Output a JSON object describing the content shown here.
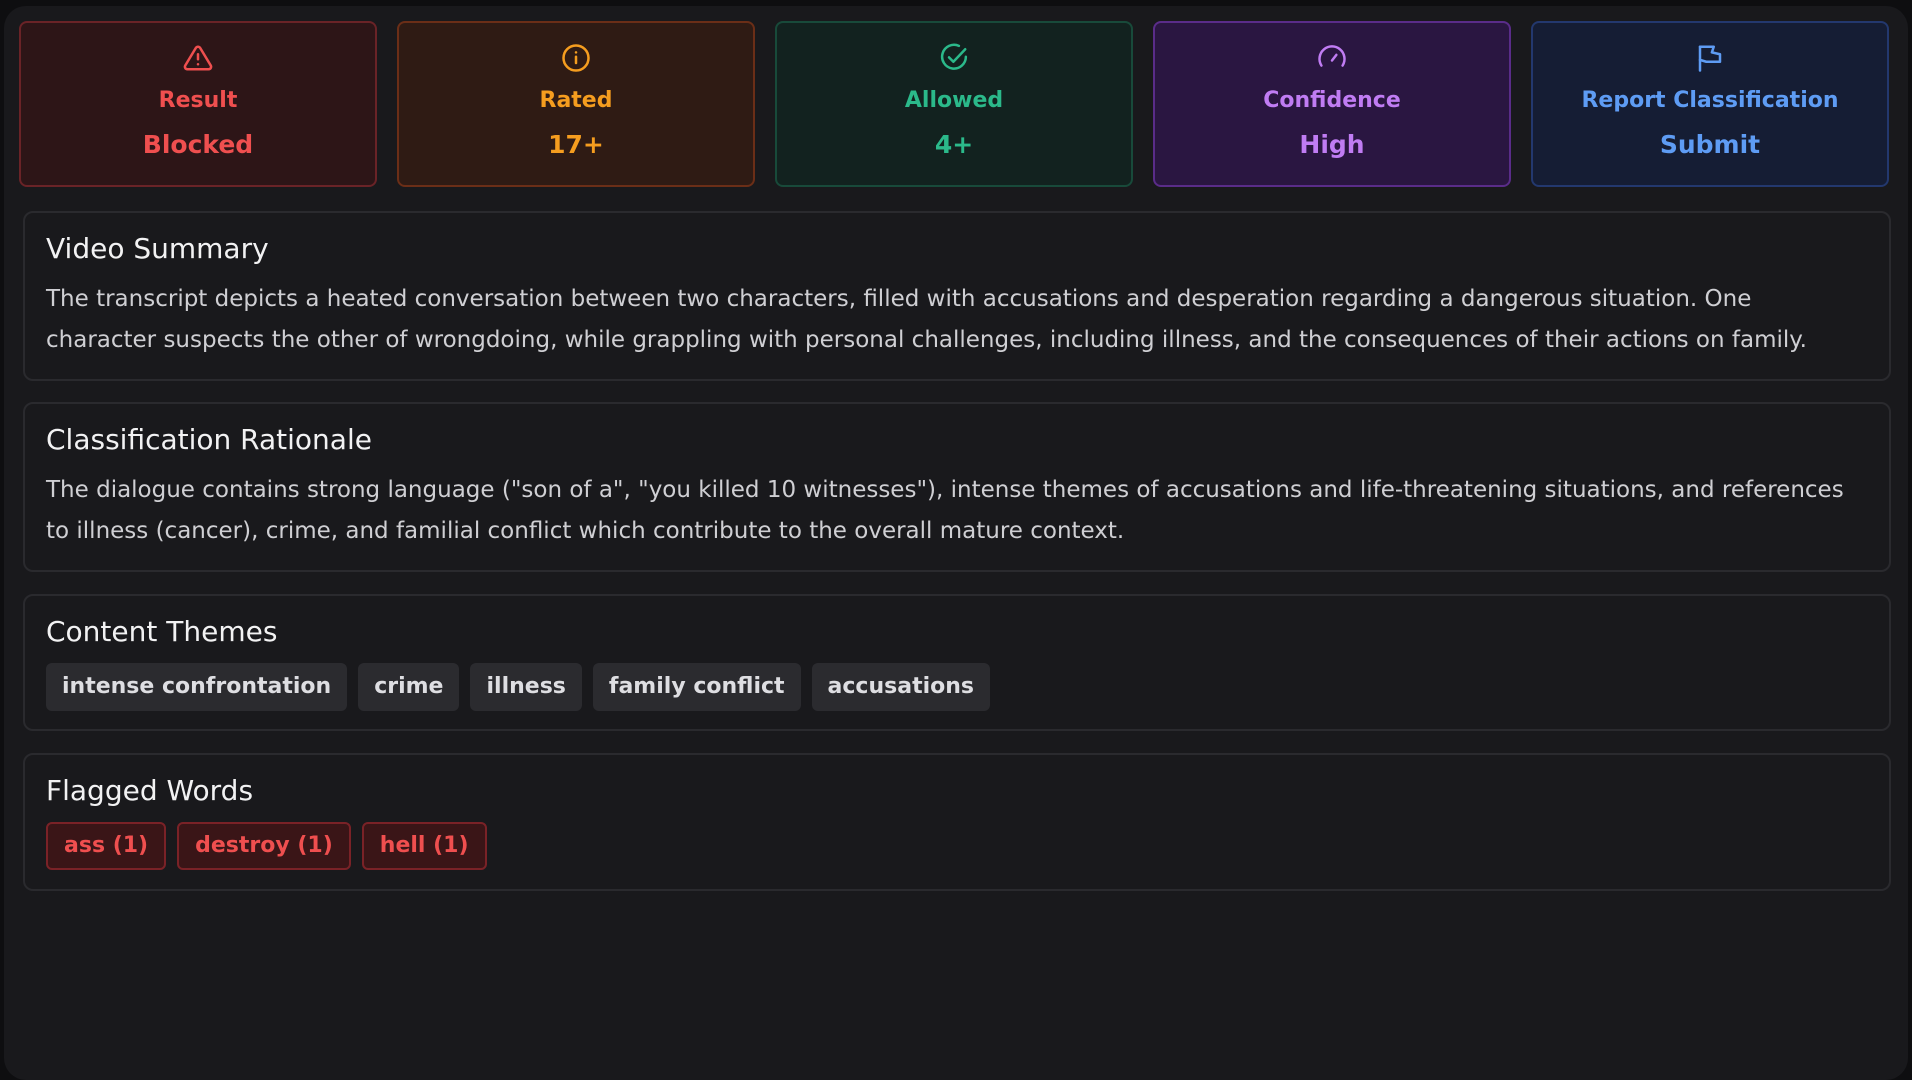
{
  "stats": [
    {
      "label": "Result",
      "value": "Blocked",
      "icon": "warning-triangle-icon",
      "color": "#ef4f4f"
    },
    {
      "label": "Rated",
      "value": "17+",
      "icon": "info-circle-icon",
      "color": "#f59d1f"
    },
    {
      "label": "Allowed",
      "value": "4+",
      "icon": "check-circle-icon",
      "color": "#2bb98a"
    },
    {
      "label": "Confidence",
      "value": "High",
      "icon": "gauge-icon",
      "color": "#c07cf3"
    },
    {
      "label": "Report Classification",
      "value": "Submit",
      "icon": "flag-icon",
      "color": "#5e9cf4"
    }
  ],
  "summary": {
    "title": "Video Summary",
    "text": "The transcript depicts a heated conversation between two characters, filled with accusations and desperation regarding a dangerous situation. One character suspects the other of wrongdoing, while grappling with personal challenges, including illness, and the consequences of their actions on family."
  },
  "rationale": {
    "title": "Classification Rationale",
    "text": "The dialogue contains strong language (\"son of a\", \"you killed 10 witnesses\"), intense themes of accusations and life-threatening situations, and references to illness (cancer), crime, and familial conflict which contribute to the overall mature context."
  },
  "themes": {
    "title": "Content Themes",
    "items": [
      "intense confrontation",
      "crime",
      "illness",
      "family conflict",
      "accusations"
    ]
  },
  "flagged": {
    "title": "Flagged Words",
    "items": [
      "ass (1)",
      "destroy (1)",
      "hell (1)"
    ]
  }
}
